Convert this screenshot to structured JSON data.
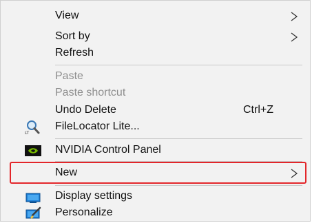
{
  "menu": {
    "items": [
      {
        "label": "View",
        "submenu": true,
        "enabled": true
      },
      {
        "label": "Sort by",
        "submenu": true,
        "enabled": true
      },
      {
        "label": "Refresh",
        "submenu": false,
        "enabled": true
      },
      {
        "label": "Paste",
        "submenu": false,
        "enabled": false
      },
      {
        "label": "Paste shortcut",
        "submenu": false,
        "enabled": false
      },
      {
        "label": "Undo Delete",
        "shortcut": "Ctrl+Z",
        "submenu": false,
        "enabled": true
      },
      {
        "label": "FileLocator Lite...",
        "icon": "magnifier-icon",
        "submenu": false,
        "enabled": true
      },
      {
        "label": "NVIDIA Control Panel",
        "icon": "nvidia-icon",
        "submenu": false,
        "enabled": true
      },
      {
        "label": "New",
        "submenu": true,
        "enabled": true,
        "highlighted": true
      },
      {
        "label": "Display settings",
        "icon": "display-icon",
        "submenu": false,
        "enabled": true
      },
      {
        "label": "Personalize",
        "icon": "personalize-icon",
        "submenu": false,
        "enabled": true
      }
    ]
  },
  "colors": {
    "background": "#f2f2f2",
    "text": "#111111",
    "disabled_text": "#8e8e8e",
    "highlight_border": "#e3262a",
    "separator": "#c9c9c9"
  }
}
